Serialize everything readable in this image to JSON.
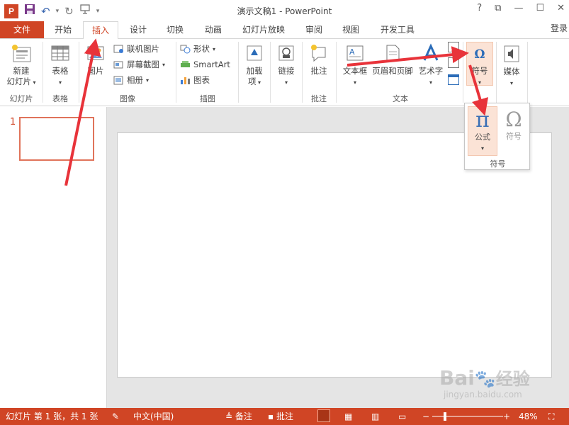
{
  "app": {
    "title": "演示文稿1 - PowerPoint",
    "logo": "P",
    "login_label": "登录"
  },
  "qat": {
    "icons": [
      "save-icon",
      "undo-icon",
      "redo-icon",
      "presentation-icon",
      "customize-icon"
    ]
  },
  "window_controls": [
    "?",
    "⧉",
    "—",
    "☐",
    "✕"
  ],
  "tabs": [
    {
      "label": "文件",
      "active": false
    },
    {
      "label": "开始",
      "active": false
    },
    {
      "label": "插入",
      "active": true
    },
    {
      "label": "设计",
      "active": false
    },
    {
      "label": "切换",
      "active": false
    },
    {
      "label": "动画",
      "active": false
    },
    {
      "label": "幻灯片放映",
      "active": false
    },
    {
      "label": "审阅",
      "active": false
    },
    {
      "label": "视图",
      "active": false
    },
    {
      "label": "开发工具",
      "active": false
    }
  ],
  "ribbon": {
    "groups": {
      "slides": "幻灯片",
      "tables": "表格",
      "images": "图像",
      "illustrations": "插图",
      "comments": "批注",
      "text": "文本"
    },
    "buttons": {
      "new_slide_line1": "新建",
      "new_slide_line2": "幻灯片",
      "table": "表格",
      "picture": "图片",
      "online_picture": "联机图片",
      "screenshot": "屏幕截图",
      "album": "相册",
      "shapes": "形状",
      "smartart": "SmartArt",
      "chart": "图表",
      "addins_line1": "加载",
      "addins_line2": "项",
      "link": "链接",
      "comment": "批注",
      "textbox": "文本框",
      "header_footer": "页眉和页脚",
      "wordart": "艺术字",
      "symbols": "符号",
      "media": "媒体"
    }
  },
  "popup": {
    "equation_label": "公式",
    "symbol_label": "符号",
    "group_label": "符号"
  },
  "slides_pane": {
    "current_number": "1"
  },
  "statusbar": {
    "slide_info": "幻灯片 第 1 张，共 1 张",
    "language": "中文(中国)",
    "notes": "备注",
    "comments": "批注",
    "zoom": "48%"
  },
  "watermark": {
    "brand": "Bai",
    "brand2": "经验",
    "url": "jingyan.baidu.com"
  },
  "colors": {
    "accent": "#d04525",
    "arrow": "#e8333a"
  }
}
